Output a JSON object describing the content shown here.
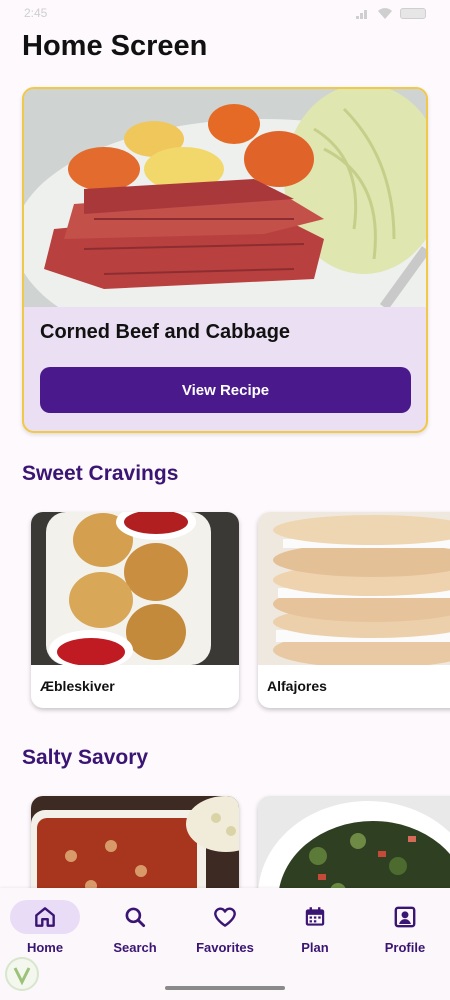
{
  "status_bar": {
    "time": "2:45"
  },
  "page": {
    "title": "Home Screen"
  },
  "featured": {
    "name": "Corned Beef and Cabbage",
    "button_label": "View Recipe"
  },
  "sections": [
    {
      "title": "Sweet Cravings",
      "items": [
        {
          "label": "Æbleskiver"
        },
        {
          "label": "Alfajores"
        }
      ]
    },
    {
      "title": "Salty Savory",
      "items": [
        {
          "label": ""
        },
        {
          "label": ""
        }
      ]
    }
  ],
  "nav": {
    "items": [
      {
        "label": "Home",
        "icon": "home-icon",
        "active": true
      },
      {
        "label": "Search",
        "icon": "search-icon",
        "active": false
      },
      {
        "label": "Favorites",
        "icon": "heart-icon",
        "active": false
      },
      {
        "label": "Plan",
        "icon": "calendar-icon",
        "active": false
      },
      {
        "label": "Profile",
        "icon": "profile-icon",
        "active": false
      }
    ]
  },
  "colors": {
    "primary": "#4a1a8c",
    "section_title": "#3a1573",
    "card_border": "#f0c948",
    "featured_bg": "#ebdff3"
  }
}
